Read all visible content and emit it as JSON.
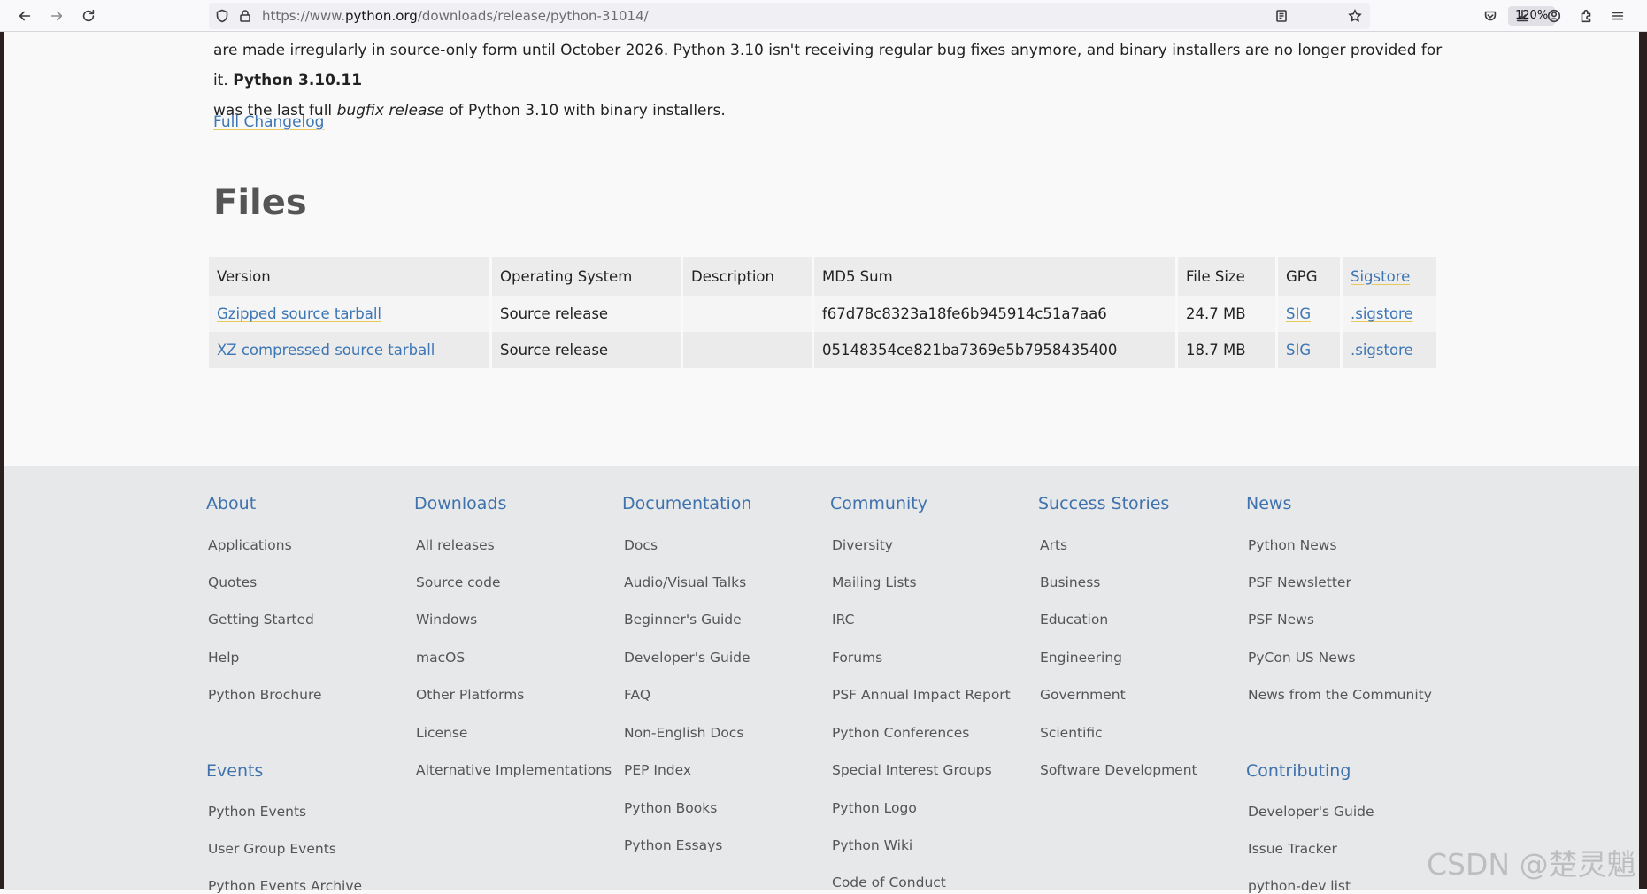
{
  "browser": {
    "url_prefix": "https://www.",
    "url_domain": "python.org",
    "url_path": "/downloads/release/python-31014/",
    "zoom": "120%"
  },
  "intro": {
    "line1_text": "are made irregularly in source-only form until October 2026. Python 3.10 isn't receiving regular bug fixes anymore, and binary installers are no longer provided for it.",
    "line1_bold": "Python 3.10.11",
    "line2_prefix": "was the last full",
    "line2_italic": "bugfix release",
    "line2_suffix": "of Python 3.10 with binary installers."
  },
  "changelog_label": "Full Changelog",
  "files": {
    "heading": "Files",
    "columns": [
      "Version",
      "Operating System",
      "Description",
      "MD5 Sum",
      "File Size",
      "GPG",
      "Sigstore"
    ],
    "rows": [
      {
        "version": "Gzipped source tarball",
        "os": "Source release",
        "description": "",
        "md5": "f67d78c8323a18fe6b945914c51a7aa6",
        "size": "24.7 MB",
        "gpg": "SIG",
        "sigstore": ".sigstore"
      },
      {
        "version": "XZ compressed source tarball",
        "os": "Source release",
        "description": "",
        "md5": "05148354ce821ba7369e5b7958435400",
        "size": "18.7 MB",
        "gpg": "SIG",
        "sigstore": ".sigstore"
      }
    ]
  },
  "footer": {
    "about": {
      "title": "About",
      "items": [
        "Applications",
        "Quotes",
        "Getting Started",
        "Help",
        "Python Brochure"
      ]
    },
    "events": {
      "title": "Events",
      "items": [
        "Python Events",
        "User Group Events",
        "Python Events Archive"
      ]
    },
    "downloads": {
      "title": "Downloads",
      "items": [
        "All releases",
        "Source code",
        "Windows",
        "macOS",
        "Other Platforms",
        "License",
        "Alternative Implementations"
      ]
    },
    "documentation": {
      "title": "Documentation",
      "items": [
        "Docs",
        "Audio/Visual Talks",
        "Beginner's Guide",
        "Developer's Guide",
        "FAQ",
        "Non-English Docs",
        "PEP Index",
        "Python Books",
        "Python Essays"
      ]
    },
    "community": {
      "title": "Community",
      "items": [
        "Diversity",
        "Mailing Lists",
        "IRC",
        "Forums",
        "PSF Annual Impact Report",
        "Python Conferences",
        "Special Interest Groups",
        "Python Logo",
        "Python Wiki",
        "Code of Conduct"
      ]
    },
    "success": {
      "title": "Success Stories",
      "items": [
        "Arts",
        "Business",
        "Education",
        "Engineering",
        "Government",
        "Scientific",
        "Software Development"
      ]
    },
    "news": {
      "title": "News",
      "items": [
        "Python News",
        "PSF Newsletter",
        "PSF News",
        "PyCon US News",
        "News from the Community"
      ]
    },
    "contributing": {
      "title": "Contributing",
      "items": [
        "Developer's Guide",
        "Issue Tracker",
        "python-dev list"
      ]
    }
  },
  "watermark": "CSDN @楚灵魈",
  "icons": [
    "back-icon",
    "forward-icon",
    "reload-icon",
    "shield-icon",
    "lock-icon",
    "reader-icon",
    "star-icon",
    "pocket-icon",
    "download-icon",
    "account-icon",
    "extensions-icon",
    "menu-icon"
  ]
}
